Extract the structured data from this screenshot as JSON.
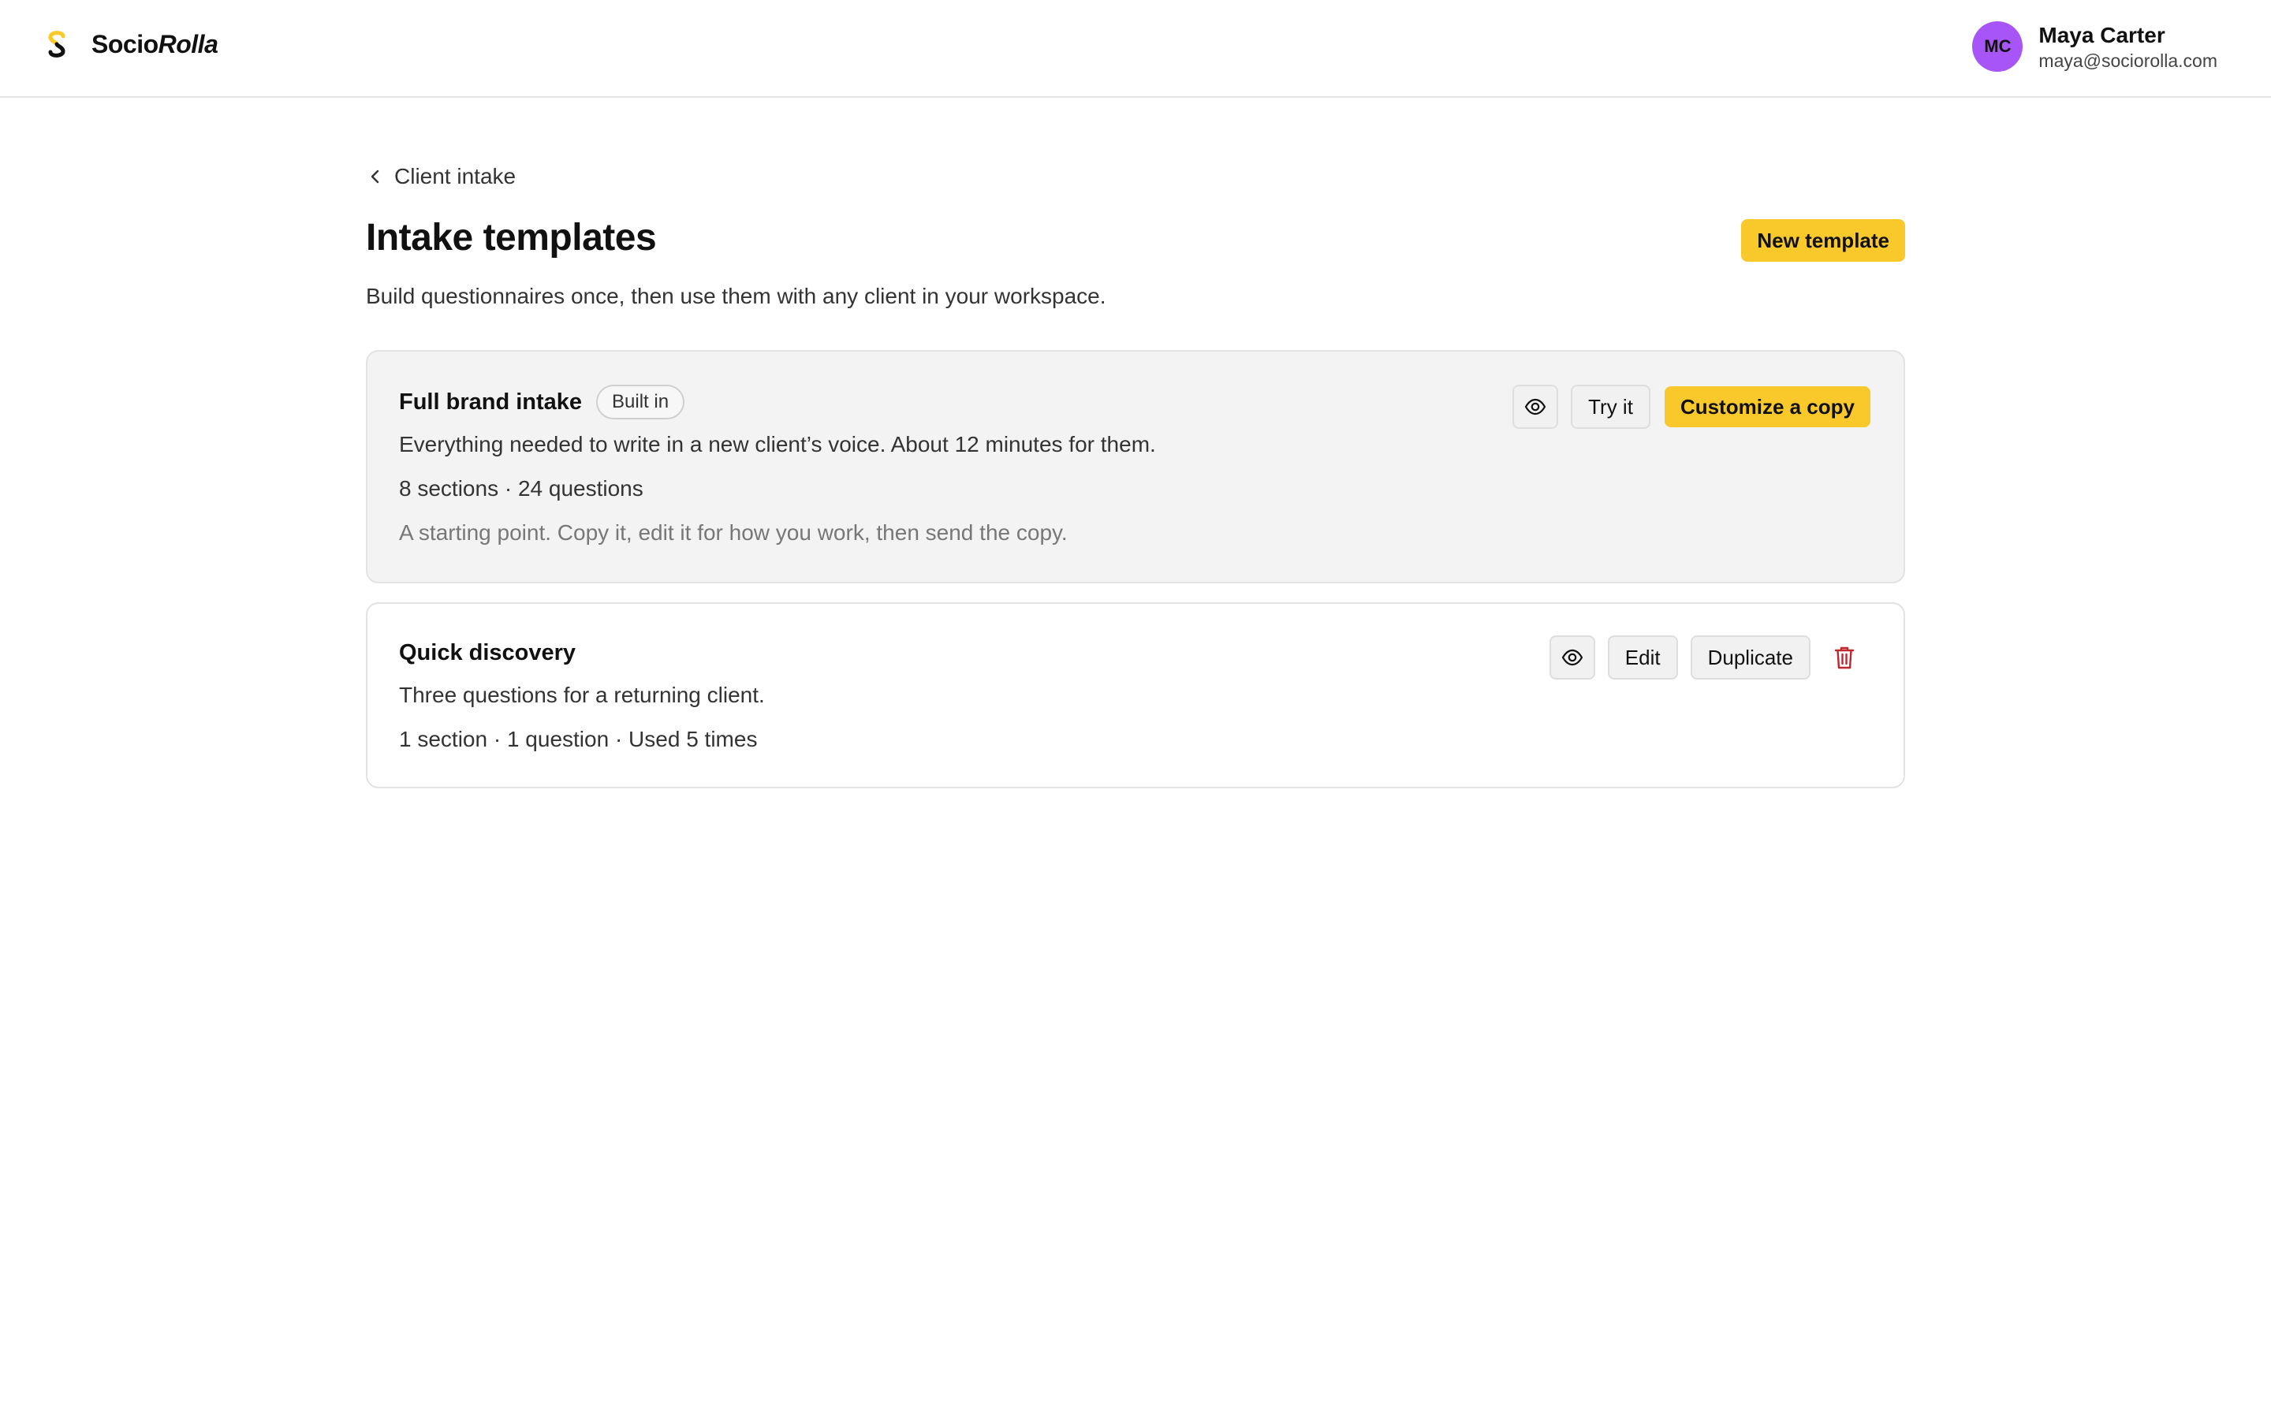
{
  "app": {
    "brand_part1": "Socio",
    "brand_part2": "Rolla",
    "accent_color": "#f9c92b",
    "avatar_color": "#a855f7",
    "danger_color": "#c0262d"
  },
  "user": {
    "initials": "MC",
    "name": "Maya Carter",
    "email": "maya@sociorolla.com"
  },
  "breadcrumb": {
    "icon": "chevron-left-icon",
    "label": "Client intake"
  },
  "page": {
    "title": "Intake templates",
    "subtitle": "Build questionnaires once, then use them with any client in your workspace.",
    "new_template_label": "New template"
  },
  "templates": [
    {
      "title": "Full brand intake",
      "badge": "Built in",
      "description": "Everything needed to write in a new client’s voice. About 12 minutes for them.",
      "meta": "8 sections · 24 questions",
      "note": "A starting point. Copy it, edit it for how you work, then send the copy.",
      "actions": {
        "preview_icon": "eye-icon",
        "try_label": "Try it",
        "customize_label": "Customize a copy"
      }
    },
    {
      "title": "Quick discovery",
      "description": "Three questions for a returning client.",
      "meta": "1 section · 1 question · Used 5 times",
      "actions": {
        "preview_icon": "eye-icon",
        "edit_label": "Edit",
        "duplicate_label": "Duplicate",
        "delete_icon": "trash-icon"
      }
    }
  ]
}
